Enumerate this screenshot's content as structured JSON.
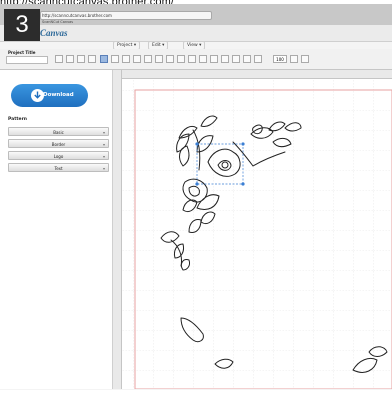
{
  "page": {
    "url_caption": "http://scanncutcanvas.brother.com/",
    "step_number": "3",
    "browser_url": "http://scanncutcanvas.brother.com",
    "browser_sub": "ScanNCut Canvas"
  },
  "app": {
    "logo": "Canvas",
    "menus": [
      {
        "label": "Project ▾"
      },
      {
        "label": "Edit ▾"
      },
      {
        "label": "View ▾"
      }
    ],
    "project_title_label": "Project Title",
    "project_title_value": "",
    "zoom_value": "100",
    "tool_icons": [
      "new-icon",
      "open-icon",
      "save-icon",
      "print-icon",
      "select-icon",
      "curve-icon",
      "draw-icon",
      "pen-icon",
      "weld-icon",
      "unite-icon",
      "intersect-icon",
      "subtract-icon",
      "group-icon",
      "align-icon",
      "zoom-icon"
    ]
  },
  "sidebar": {
    "download_label": "Download",
    "pattern_label": "Pattern",
    "categories": [
      {
        "label": "Basic"
      },
      {
        "label": "Border"
      },
      {
        "label": "Logo"
      },
      {
        "label": "Text"
      }
    ]
  },
  "colors": {
    "accent": "#2a7fd0",
    "grid": "#d6d6d6",
    "mat_border": "#e7a2a2",
    "selection": "#3b7fd4"
  }
}
